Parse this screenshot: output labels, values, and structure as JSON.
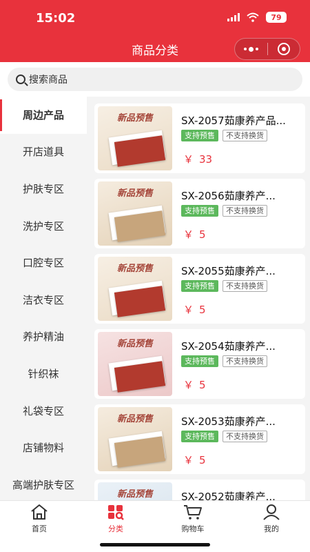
{
  "status_bar": {
    "time": "15:02",
    "battery": "79"
  },
  "nav": {
    "title": "商品分类"
  },
  "search": {
    "placeholder": "搜索商品"
  },
  "sidebar": {
    "items": [
      {
        "label": "周边产品"
      },
      {
        "label": "开店道具"
      },
      {
        "label": "护肤专区"
      },
      {
        "label": "洗护专区"
      },
      {
        "label": "口腔专区"
      },
      {
        "label": "洁衣专区"
      },
      {
        "label": "养护精油"
      },
      {
        "label": "针织袜"
      },
      {
        "label": "礼袋专区"
      },
      {
        "label": "店铺物料"
      },
      {
        "label": "高端护肤专区"
      }
    ]
  },
  "products": [
    {
      "name": "SX-2057茹康养产品...",
      "tag_presale": "支持预售",
      "tag_noexchange": "不支持换货",
      "currency": "￥",
      "price": "33",
      "thumb_title": "新品预售"
    },
    {
      "name": "SX-2056茹康养产...",
      "tag_presale": "支持预售",
      "tag_noexchange": "不支持换货",
      "currency": "￥",
      "price": "5",
      "thumb_title": "新品预售"
    },
    {
      "name": "SX-2055茹康养产...",
      "tag_presale": "支持预售",
      "tag_noexchange": "不支持换货",
      "currency": "￥",
      "price": "5",
      "thumb_title": "新品预售"
    },
    {
      "name": "SX-2054茹康养产...",
      "tag_presale": "支持预售",
      "tag_noexchange": "不支持换货",
      "currency": "￥",
      "price": "5",
      "thumb_title": "新品预售"
    },
    {
      "name": "SX-2053茹康养产...",
      "tag_presale": "支持预售",
      "tag_noexchange": "不支持换货",
      "currency": "￥",
      "price": "5",
      "thumb_title": "新品预售"
    },
    {
      "name": "SX-2052茹康养产...",
      "tag_presale": "",
      "tag_noexchange": "",
      "currency": "",
      "price": "",
      "thumb_title": "新品预售"
    }
  ],
  "tabbar": {
    "home": "首页",
    "category": "分类",
    "cart": "购物车",
    "mine": "我的"
  },
  "colors": {
    "brand": "#e8323c",
    "tag_green": "#5cb85c"
  }
}
